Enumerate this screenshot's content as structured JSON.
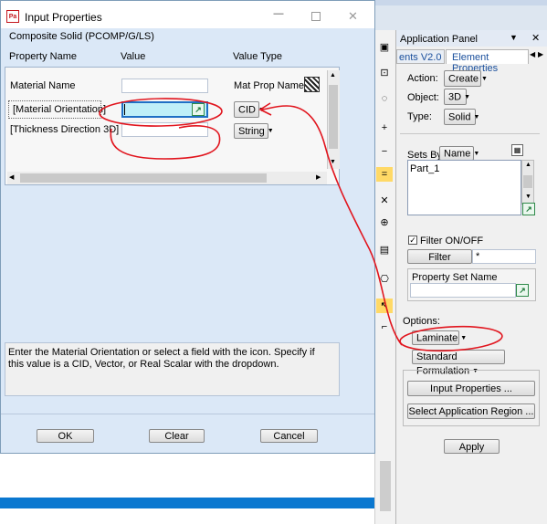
{
  "dialog": {
    "title": "Input Properties",
    "subtitle": "Composite Solid (PCOMP/G/LS)",
    "columns": {
      "property": "Property Name",
      "value": "Value",
      "type": "Value Type"
    },
    "rows": [
      {
        "name": "Material Name",
        "value": "",
        "type": "Mat Prop Name"
      },
      {
        "name": "[Material Orientation]",
        "value": "",
        "type": "CID"
      },
      {
        "name": "[Thickness Direction 3D]",
        "value": "",
        "type": "String"
      }
    ],
    "help": "Enter the Material Orientation or select a field with the icon.  Specify if this value is a CID, Vector, or Real Scalar with the dropdown.",
    "ok": "OK",
    "clear": "Clear",
    "cancel": "Cancel"
  },
  "panel": {
    "title": "Application Panel",
    "tab_left": "ents V2.0",
    "tab_right": "Element Properties",
    "action_label": "Action:",
    "action_value": "Create",
    "object_label": "Object:",
    "object_value": "3D",
    "type_label": "Type:",
    "type_value": "Solid",
    "sets_by_label": "Sets By:",
    "sets_by_value": "Name",
    "list_items": [
      "Part_1"
    ],
    "filter_label": "Filter ON/OFF",
    "filter_button": "Filter",
    "filter_value": "*",
    "property_set_label": "Property Set Name",
    "options_label": "Options:",
    "options_value": "Laminate",
    "formulation_value": "Standard Formulation",
    "input_properties": "Input Properties ...",
    "select_region": "Select Application Region ...",
    "apply": "Apply"
  },
  "colors": {
    "accent": "#e1151e",
    "dialog_bg": "#dbe8f7",
    "panel_bg": "#f0f0f0",
    "taskbar": "#0b78d0"
  }
}
